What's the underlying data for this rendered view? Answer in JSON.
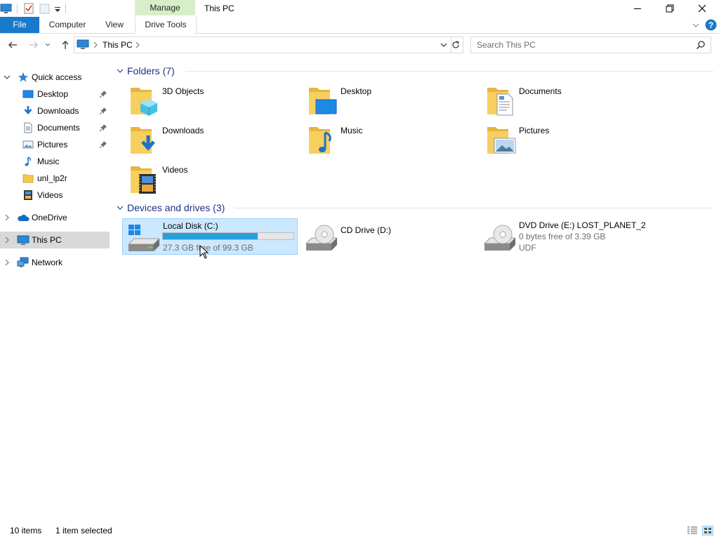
{
  "ribbon": {
    "context_header": "Manage",
    "window_title": "This PC",
    "tabs": {
      "file": "File",
      "computer": "Computer",
      "view": "View",
      "drive_tools": "Drive Tools"
    }
  },
  "address": {
    "location": "This PC",
    "search_placeholder": "Search This PC"
  },
  "sidebar": {
    "quick_access": "Quick access",
    "items": [
      {
        "label": "Desktop",
        "icon": "desktop-icon",
        "pinned": true
      },
      {
        "label": "Downloads",
        "icon": "downloads-icon",
        "pinned": true
      },
      {
        "label": "Documents",
        "icon": "documents-icon",
        "pinned": true
      },
      {
        "label": "Pictures",
        "icon": "pictures-icon",
        "pinned": true
      },
      {
        "label": "Music",
        "icon": "music-icon",
        "pinned": false
      },
      {
        "label": "unl_lp2r",
        "icon": "folder-icon",
        "pinned": false
      },
      {
        "label": "Videos",
        "icon": "videos-icon",
        "pinned": false
      }
    ],
    "onedrive": "OneDrive",
    "this_pc": "This PC",
    "network": "Network"
  },
  "content": {
    "folders_header": "Folders (7)",
    "folders": [
      {
        "name": "3D Objects",
        "icon": "3d-objects-folder-icon"
      },
      {
        "name": "Desktop",
        "icon": "desktop-folder-icon"
      },
      {
        "name": "Documents",
        "icon": "documents-folder-icon"
      },
      {
        "name": "Downloads",
        "icon": "downloads-folder-icon"
      },
      {
        "name": "Music",
        "icon": "music-folder-icon"
      },
      {
        "name": "Pictures",
        "icon": "pictures-folder-icon"
      },
      {
        "name": "Videos",
        "icon": "videos-folder-icon"
      }
    ],
    "drives_header": "Devices and drives (3)",
    "drives": [
      {
        "name": "Local Disk (C:)",
        "detail": "27.3 GB free of 99.3 GB",
        "used_fraction": 0.725,
        "icon": "windows-drive-icon",
        "selected": true
      },
      {
        "name": "CD Drive (D:)",
        "icon": "cd-drive-icon"
      },
      {
        "name": "DVD Drive (E:) LOST_PLANET_2",
        "detail": "0 bytes free of 3.39 GB",
        "filesystem": "UDF",
        "icon": "dvd-drive-icon"
      }
    ]
  },
  "status": {
    "item_count": "10 items",
    "selection": "1 item selected"
  },
  "colors": {
    "accent": "#1979ca",
    "selection_bg": "#cce8ff",
    "selection_border": "#99d1ff",
    "group_header": "#1e3287",
    "capacity_bar": "#26a0da",
    "context_tab": "#d7efc9"
  }
}
